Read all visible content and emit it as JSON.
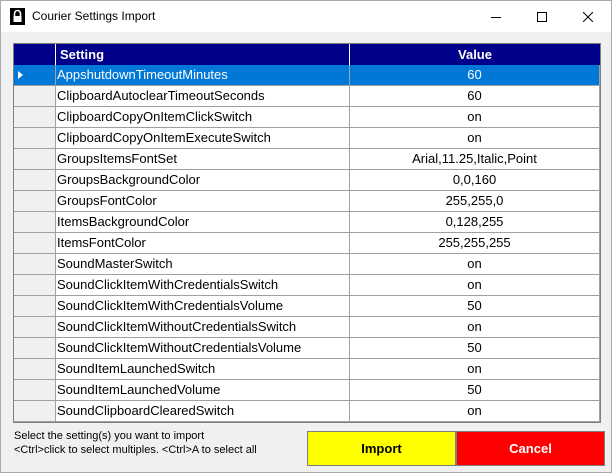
{
  "window": {
    "title": "Courier Settings Import"
  },
  "grid": {
    "columns": {
      "setting": "Setting",
      "value": "Value"
    },
    "selected_index": 0,
    "rows": [
      {
        "setting": "AppshutdownTimeoutMinutes",
        "value": "60"
      },
      {
        "setting": "ClipboardAutoclearTimeoutSeconds",
        "value": "60"
      },
      {
        "setting": "ClipboardCopyOnItemClickSwitch",
        "value": "on"
      },
      {
        "setting": "ClipboardCopyOnItemExecuteSwitch",
        "value": "on"
      },
      {
        "setting": "GroupsItemsFontSet",
        "value": "Arial,11.25,Italic,Point"
      },
      {
        "setting": "GroupsBackgroundColor",
        "value": "0,0,160"
      },
      {
        "setting": "GroupsFontColor",
        "value": "255,255,0"
      },
      {
        "setting": "ItemsBackgroundColor",
        "value": "0,128,255"
      },
      {
        "setting": "ItemsFontColor",
        "value": "255,255,255"
      },
      {
        "setting": "SoundMasterSwitch",
        "value": "on"
      },
      {
        "setting": "SoundClickItemWithCredentialsSwitch",
        "value": "on"
      },
      {
        "setting": "SoundClickItemWithCredentialsVolume",
        "value": "50"
      },
      {
        "setting": "SoundClickItemWithoutCredentialsSwitch",
        "value": "on"
      },
      {
        "setting": "SoundClickItemWithoutCredentialsVolume",
        "value": "50"
      },
      {
        "setting": "SoundItemLaunchedSwitch",
        "value": "on"
      },
      {
        "setting": "SoundItemLaunchedVolume",
        "value": "50"
      },
      {
        "setting": "SoundClipboardClearedSwitch",
        "value": "on"
      }
    ]
  },
  "footer": {
    "hint_line1": "Select the setting(s) you want to import",
    "hint_line2": "<Ctrl>click to select multiples. <Ctrl>A to select all",
    "import_label": "Import",
    "cancel_label": "Cancel"
  },
  "colors": {
    "header_bg": "#00008b",
    "selection_bg": "#0078d7",
    "import_bg": "#ffff00",
    "cancel_bg": "#ff0000"
  },
  "icons": {
    "app": "padlock-icon",
    "minimize": "minimize-icon",
    "maximize": "maximize-icon",
    "close": "close-icon",
    "row_pointer": "row-pointer-icon"
  }
}
